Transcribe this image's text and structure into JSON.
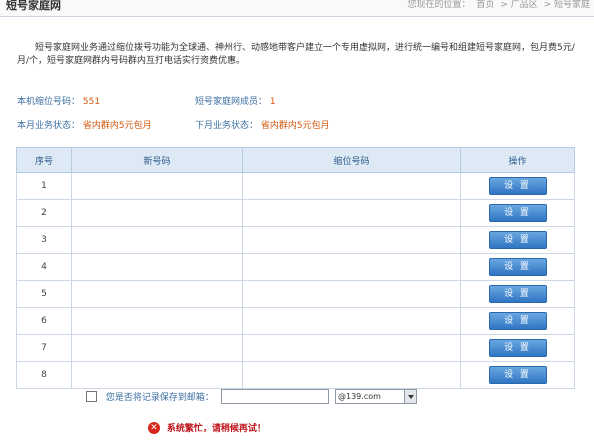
{
  "header": {
    "title": "短号家庭网",
    "breadcrumb": [
      "您现在的位置：",
      "首页",
      "> 广品区",
      "> 短号家庭"
    ]
  },
  "description": "短号家庭网业务通过缩位拨号功能为全球通、神州行、动感地带客户建立一个专用虚拟网，进行统一编号和组建短号家庭网，包月费5元/月/个，短号家庭网群内号码群内互打电话实行资费优惠。",
  "info": {
    "short_code_label": "本机缩位号码：",
    "short_code_value": "551",
    "members_label": "短号家庭网成员：",
    "members_value": "1",
    "current_status_label": "本月业务状态：",
    "current_status_value": "省内群内5元包月",
    "next_status_label": "下月业务状态：",
    "next_status_value": "省内群内5元包月"
  },
  "table": {
    "headers": [
      "序号",
      "新号码",
      "缩位号码",
      "操作"
    ],
    "rows": [
      {
        "index": "1",
        "new_number": "",
        "short_code": "",
        "action": "设 置"
      },
      {
        "index": "2",
        "new_number": "",
        "short_code": "",
        "action": "设 置"
      },
      {
        "index": "3",
        "new_number": "",
        "short_code": "",
        "action": "设 置"
      },
      {
        "index": "4",
        "new_number": "",
        "short_code": "",
        "action": "设 置"
      },
      {
        "index": "5",
        "new_number": "",
        "short_code": "",
        "action": "设 置"
      },
      {
        "index": "6",
        "new_number": "",
        "short_code": "",
        "action": "设 置"
      },
      {
        "index": "7",
        "new_number": "",
        "short_code": "",
        "action": "设 置"
      },
      {
        "index": "8",
        "new_number": "",
        "short_code": "",
        "action": "设 置"
      }
    ]
  },
  "save": {
    "label": "您是否将记录保存到邮箱：",
    "email_value": "",
    "domain_selected": "@139.com",
    "checked": false
  },
  "error": {
    "icon": "x-circle-icon",
    "message": "系统繁忙，请稍候再试！",
    "color": "#c0141c"
  }
}
